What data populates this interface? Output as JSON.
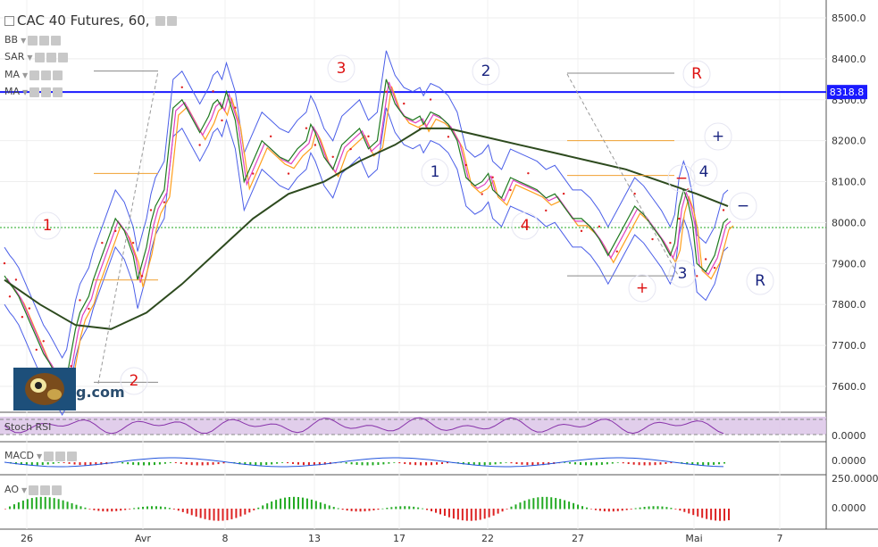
{
  "chart_data": {
    "type": "line",
    "title": "CAC 40 Futures, 60,",
    "instrument": "CAC 40 Futures",
    "timeframe": "60",
    "ylim": [
      7540,
      8540
    ],
    "y_ticks": [
      "8500.0",
      "8400.0",
      "8300.0",
      "8200.0",
      "8100.0",
      "8000.0",
      "7900.0",
      "7800.0",
      "7700.0",
      "7600.0"
    ],
    "x_ticks": [
      "26",
      "Avr",
      "8",
      "13",
      "17",
      "22",
      "27",
      "Mai",
      "7"
    ],
    "price_label": "8318.8",
    "resistance_level": 8318.8,
    "resistance_color": "#1a1aff",
    "support_dotted_level": 7988,
    "series": [
      {
        "name": "price",
        "x": [
          0,
          3,
          6,
          10,
          13,
          16,
          20,
          24,
          28,
          32,
          36,
          40,
          44,
          50,
          55,
          60,
          65,
          70,
          75,
          80,
          85,
          90,
          95,
          100,
          110,
          120,
          125,
          135,
          145,
          150,
          155,
          160,
          165,
          170,
          180,
          190,
          200,
          210,
          220,
          230,
          235,
          240,
          245,
          250,
          260,
          270,
          280,
          290,
          300,
          310,
          320,
          330,
          340,
          345,
          350,
          360,
          370,
          380,
          390,
          400,
          410,
          420,
          430,
          440,
          450,
          460,
          468,
          472,
          480,
          490,
          500,
          510,
          520,
          530,
          538,
          545,
          550,
          560,
          570,
          580,
          590,
          600,
          610,
          620,
          630,
          640,
          650,
          660,
          670,
          680,
          690,
          700,
          710,
          720,
          730,
          740,
          750,
          755,
          760,
          765,
          770,
          775,
          780,
          785,
          790,
          795,
          800,
          805,
          810,
          815
        ],
        "values": [
          7870,
          7860,
          7850,
          7840,
          7830,
          7820,
          7800,
          7780,
          7760,
          7740,
          7720,
          7700,
          7680,
          7660,
          7640,
          7620,
          7600,
          7620,
          7680,
          7740,
          7780,
          7800,
          7820,
          7860,
          7920,
          7980,
          8010,
          7980,
          7920,
          7860,
          7900,
          7940,
          8000,
          8040,
          8080,
          8280,
          8300,
          8260,
          8220,
          8260,
          8290,
          8300,
          8280,
          8320,
          8250,
          8100,
          8150,
          8200,
          8180,
          8160,
          8150,
          8180,
          8200,
          8240,
          8220,
          8160,
          8130,
          8190,
          8210,
          8230,
          8180,
          8200,
          8350,
          8290,
          8260,
          8250,
          8260,
          8240,
          8270,
          8260,
          8240,
          8200,
          8110,
          8090,
          8100,
          8120,
          8080,
          8060,
          8110,
          8100,
          8090,
          8080,
          8060,
          8070,
          8040,
          8010,
          8010,
          7990,
          7960,
          7920,
          7960,
          8000,
          8040,
          8020,
          7990,
          7960,
          7920,
          7950,
          8040,
          8080,
          8050,
          8000,
          7900,
          7890,
          7880,
          7900,
          7920,
          7960,
          8000,
          8010
        ]
      },
      {
        "name": "ma200",
        "x": [
          0,
          40,
          80,
          120,
          160,
          200,
          240,
          280,
          320,
          360,
          400,
          440,
          470,
          500,
          540,
          580,
          620,
          660,
          700,
          740,
          780,
          815
        ],
        "values": [
          7860,
          7800,
          7750,
          7740,
          7780,
          7850,
          7930,
          8010,
          8070,
          8100,
          8150,
          8190,
          8230,
          8230,
          8210,
          8190,
          8170,
          8150,
          8130,
          8100,
          8070,
          8040
        ]
      }
    ],
    "wave_labels": [
      {
        "text": "1",
        "color": "red"
      },
      {
        "text": "2",
        "color": "red"
      },
      {
        "text": "3",
        "color": "red"
      },
      {
        "text": "4",
        "color": "red"
      },
      {
        "text": "1",
        "color": "navy"
      },
      {
        "text": "2",
        "color": "navy"
      },
      {
        "text": "3",
        "color": "navy"
      },
      {
        "text": "4",
        "color": "navy"
      },
      {
        "text": "R",
        "color": "red"
      },
      {
        "text": "R",
        "color": "navy"
      },
      {
        "text": "+",
        "color": "red"
      },
      {
        "text": "+",
        "color": "navy"
      },
      {
        "text": "−",
        "color": "red"
      },
      {
        "text": "−",
        "color": "navy"
      }
    ],
    "panels": {
      "stoch_rsi": {
        "name": "Stoch RSI",
        "tick": "0.0000"
      },
      "macd": {
        "name": "MACD",
        "tick": "0.0000"
      },
      "ao": {
        "name": "AO",
        "ticks": [
          "250.0000",
          "0.0000"
        ]
      }
    }
  },
  "indicators": [
    "BB",
    "SAR",
    "MA",
    "MA"
  ],
  "logo_text": "g.com"
}
